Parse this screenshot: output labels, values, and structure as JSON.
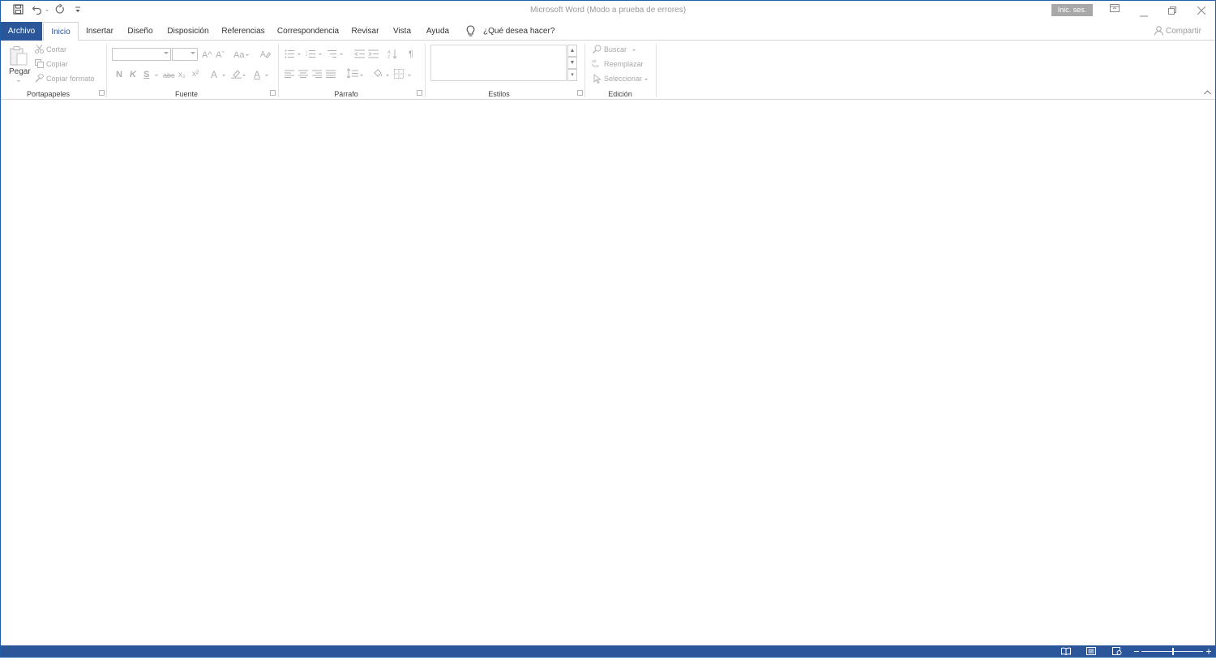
{
  "window": {
    "title": "Microsoft Word (Modo a prueba de errores)",
    "signin_label": "Inic. ses.",
    "share_label": "Compartir",
    "tell_me_placeholder": "¿Qué desea hacer?"
  },
  "tabs": [
    {
      "label": "Archivo"
    },
    {
      "label": "Inicio"
    },
    {
      "label": "Insertar"
    },
    {
      "label": "Diseño"
    },
    {
      "label": "Disposición"
    },
    {
      "label": "Referencias"
    },
    {
      "label": "Correspondencia"
    },
    {
      "label": "Revisar"
    },
    {
      "label": "Vista"
    },
    {
      "label": "Ayuda"
    }
  ],
  "active_tab": "Inicio",
  "ribbon": {
    "clipboard": {
      "group_label": "Portapapeles",
      "paste_label": "Pegar",
      "cut_label": "Cortar",
      "copy_label": "Copiar",
      "format_painter_label": "Copiar formato"
    },
    "font": {
      "group_label": "Fuente",
      "font_name": "",
      "font_size": "",
      "bold_glyph": "N",
      "italic_glyph": "K",
      "underline_glyph": "S",
      "strike_glyph": "abc",
      "subscript_glyph": "x₂",
      "superscript_glyph": "x²",
      "grow_glyph": "A^",
      "shrink_glyph": "Aˇ",
      "case_glyph": "Aa",
      "text_effects_glyph": "A",
      "font_color_glyph": "A"
    },
    "paragraph": {
      "group_label": "Párrafo",
      "show_marks_glyph": "¶"
    },
    "styles": {
      "group_label": "Estilos"
    },
    "editing": {
      "group_label": "Edición",
      "find_label": "Buscar",
      "replace_label": "Reemplazar",
      "select_label": "Seleccionar"
    }
  },
  "colors": {
    "accent": "#2b579a",
    "disabled": "#a8a8a8"
  }
}
